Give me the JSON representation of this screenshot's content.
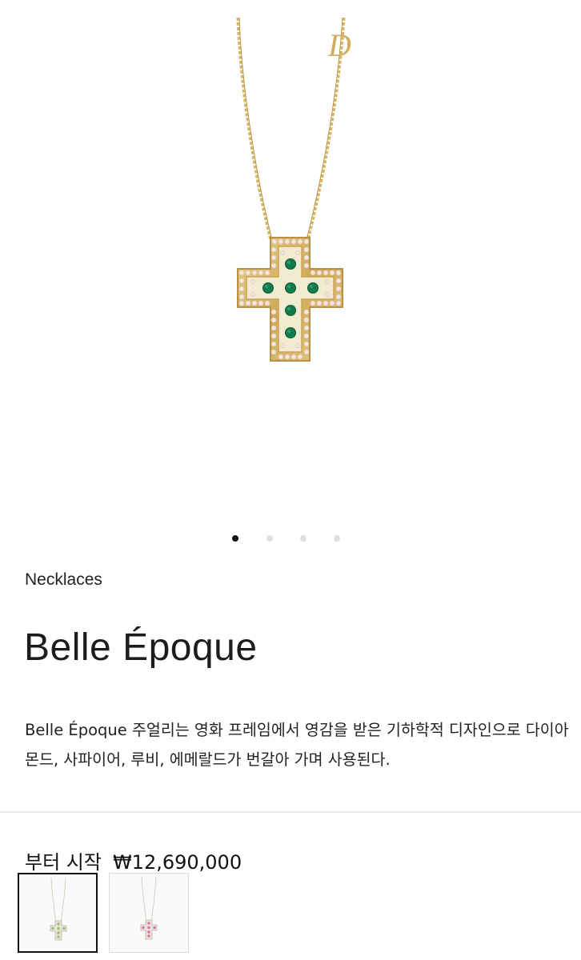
{
  "gallery": {
    "slide_count": 4,
    "active_index": 0
  },
  "product": {
    "category": "Necklaces",
    "name": "Belle Époque",
    "description": "Belle Époque 주얼리는 영화 프레임에서 영감을 받은 기하학적 디자인으로 다이아몬드, 사파이어, 루비, 에메랄드가 번갈아 가며 사용된다.",
    "price_prefix": "부터 시작",
    "price": "₩12,690,000"
  },
  "variants": [
    {
      "name": "green-stone-variant",
      "selected": true,
      "stone_color": "#8fc26a"
    },
    {
      "name": "pink-stone-variant",
      "selected": false,
      "stone_color": "#e7669a"
    }
  ],
  "colors": {
    "gold": "#d8b96a",
    "emerald": "#137a4b",
    "diamond": "#f1e1d6",
    "dot_active": "#111111",
    "dot_inactive": "#dedede"
  }
}
